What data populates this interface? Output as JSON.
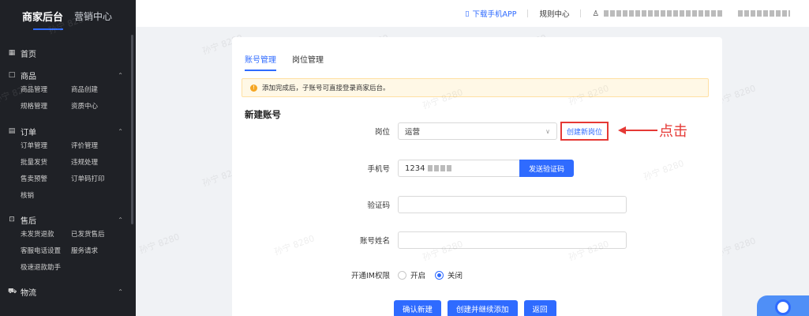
{
  "sidebar": {
    "brand_title": "商家后台",
    "brand_sub": "营销中心",
    "home": "首页",
    "groups": [
      {
        "title": "商品",
        "items": [
          "商品管理",
          "商品创建",
          "规格管理",
          "资质中心"
        ]
      },
      {
        "title": "订单",
        "items": [
          "订单管理",
          "评价管理",
          "批量发货",
          "违规处理",
          "售卖预警",
          "订单码打印",
          "核销"
        ]
      },
      {
        "title": "售后",
        "items": [
          "未发货退款",
          "已发货售后",
          "客服电话设置",
          "服务请求",
          "极速退款助手"
        ]
      },
      {
        "title": "物流",
        "items": []
      }
    ]
  },
  "topbar": {
    "download_app": "下载手机APP",
    "rules_center": "规则中心"
  },
  "tabs": [
    "账号管理",
    "岗位管理"
  ],
  "alert_text": "添加完成后，子账号可直接登录商家后台。",
  "section_title": "新建账号",
  "form": {
    "position_label": "岗位",
    "position_value": "运营",
    "create_position": "创建新岗位",
    "phone_label": "手机号",
    "phone_value": "1234",
    "send_code": "发送验证码",
    "code_label": "验证码",
    "name_label": "账号姓名",
    "im_label": "开通IM权限",
    "im_on": "开启",
    "im_off": "关闭",
    "im_selected": "关闭"
  },
  "actions": [
    "确认新建",
    "创建并继续添加",
    "返回"
  ],
  "annotation": "点击",
  "watermark": "孙宁 8280",
  "colors": {
    "primary": "#2f6bff",
    "annotation": "#e53935",
    "sidebar_bg": "#1f2126"
  }
}
